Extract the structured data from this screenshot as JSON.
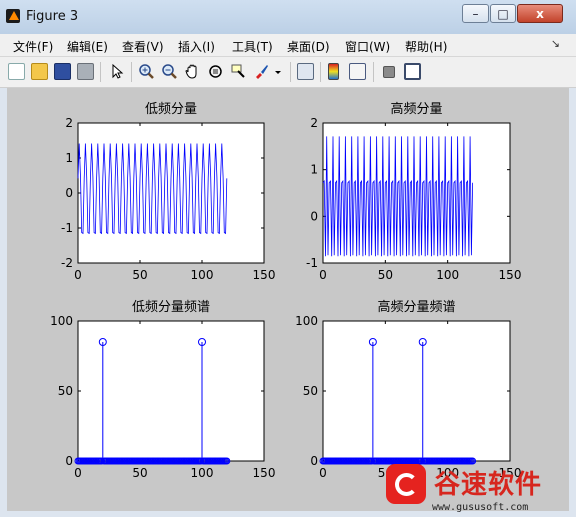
{
  "window": {
    "title": "Figure 3",
    "controls": {
      "minimize": "–",
      "maximize": "□",
      "close": "x"
    }
  },
  "menu": {
    "items": [
      "文件(F)",
      "编辑(E)",
      "查看(V)",
      "插入(I)",
      "工具(T)",
      "桌面(D)",
      "窗口(W)",
      "帮助(H)"
    ],
    "overflow_arrow": "↘"
  },
  "toolbar": {
    "icons": [
      "new-figure-icon",
      "open-file-icon",
      "save-icon",
      "print-icon",
      "edit-plot-arrow-icon",
      "zoom-in-icon",
      "zoom-out-icon",
      "pan-hand-icon",
      "rotate-3d-icon",
      "data-cursor-icon",
      "brush-icon",
      "brush-dropdown-icon",
      "link-plot-icon",
      "colorbar-icon",
      "legend-icon",
      "hide-plot-tools-icon",
      "show-plot-tools-icon"
    ]
  },
  "colors": {
    "figure_bg": "#c8c8c8",
    "axes_bg": "#ffffff",
    "line": "#0000ff"
  },
  "chart_data": [
    {
      "type": "line",
      "title": "低频分量",
      "xlim": [
        0,
        150
      ],
      "ylim": [
        -2,
        2
      ],
      "xticks": [
        0,
        50,
        100,
        150
      ],
      "yticks": [
        -2,
        -1,
        0,
        1,
        2
      ],
      "series": [
        {
          "description_of_signal": "",
          "x_range": [
            0,
            120
          ],
          "amplitude": 1.414,
          "cycles_per_sample": 0.2
        }
      ]
    },
    {
      "type": "line",
      "title": "高频分量",
      "xlim": [
        0,
        150
      ],
      "ylim": [
        -1,
        2
      ],
      "xticks": [
        0,
        50,
        100,
        150
      ],
      "yticks": [
        -1,
        0,
        1,
        2
      ],
      "series": [
        {
          "x_range": [
            0,
            120
          ],
          "amplitude": 1.414,
          "offset": 0.3,
          "cycles_per_sample": 0.4
        }
      ]
    },
    {
      "type": "stem",
      "title": "低频分量频谱",
      "xlim": [
        0,
        150
      ],
      "ylim": [
        0,
        100
      ],
      "xticks": [
        0,
        50,
        100,
        150
      ],
      "yticks": [
        0,
        50,
        100
      ],
      "x_range": [
        0,
        120
      ],
      "peaks": [
        {
          "x": 20,
          "y": 85
        },
        {
          "x": 100,
          "y": 85
        }
      ],
      "baseline_value": 0
    },
    {
      "type": "stem",
      "title": "高频分量频谱",
      "xlim": [
        0,
        150
      ],
      "ylim": [
        0,
        100
      ],
      "xticks": [
        0,
        50,
        100,
        150
      ],
      "yticks": [
        0,
        50,
        100
      ],
      "x_range": [
        0,
        120
      ],
      "peaks": [
        {
          "x": 40,
          "y": 85
        },
        {
          "x": 80,
          "y": 85
        }
      ],
      "baseline_value": 0
    }
  ],
  "watermark": {
    "brand": "谷速软件",
    "url": "www.gususoft.com"
  }
}
